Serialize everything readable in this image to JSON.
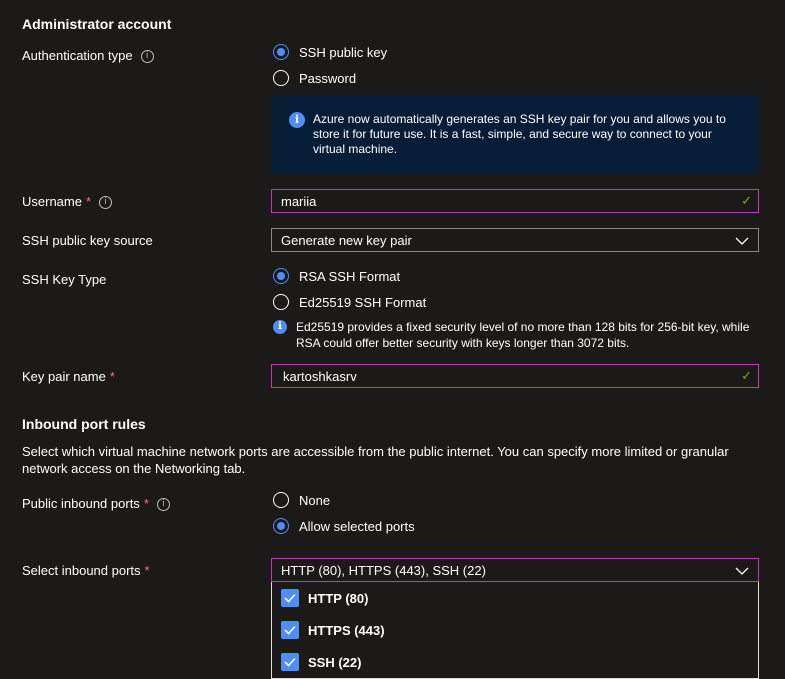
{
  "admin": {
    "section_title": "Administrator account",
    "auth_type_label": "Authentication type",
    "auth_options": [
      "SSH public key",
      "Password"
    ],
    "auth_selected": "SSH public key",
    "auth_info": "Azure now automatically generates an SSH key pair for you and allows you to store it for future use. It is a fast, simple, and secure way to connect to your virtual machine.",
    "username_label": "Username",
    "username_value": "mariia",
    "key_source_label": "SSH public key source",
    "key_source_value": "Generate new key pair",
    "key_type_label": "SSH Key Type",
    "key_type_options": [
      "RSA SSH Format",
      "Ed25519 SSH Format"
    ],
    "key_type_selected": "RSA SSH Format",
    "key_type_info": "Ed25519 provides a fixed security level of no more than 128 bits for 256-bit key, while RSA could offer better security with keys longer than 3072 bits.",
    "key_pair_label": "Key pair name",
    "key_pair_value": "kartoshkasrv"
  },
  "inbound": {
    "section_title": "Inbound port rules",
    "description": "Select which virtual machine network ports are accessible from the public internet. You can specify more limited or granular network access on the Networking tab.",
    "public_ports_label": "Public inbound ports",
    "public_ports_options": [
      "None",
      "Allow selected ports"
    ],
    "public_ports_selected": "Allow selected ports",
    "select_ports_label": "Select inbound ports",
    "select_ports_value": "HTTP (80), HTTPS (443), SSH (22)",
    "port_options": [
      {
        "label": "HTTP (80)",
        "checked": true
      },
      {
        "label": "HTTPS (443)",
        "checked": true
      },
      {
        "label": "SSH (22)",
        "checked": true
      }
    ]
  },
  "colors": {
    "accent": "#4f8ef7",
    "focus_border": "#c239b3",
    "required": "#f1707b",
    "valid": "#6bb700",
    "info_bg": "#061d36"
  },
  "icons": {
    "info": "info-circle-icon",
    "valid": "checkmark-icon",
    "dropdown": "chevron-down-icon"
  }
}
